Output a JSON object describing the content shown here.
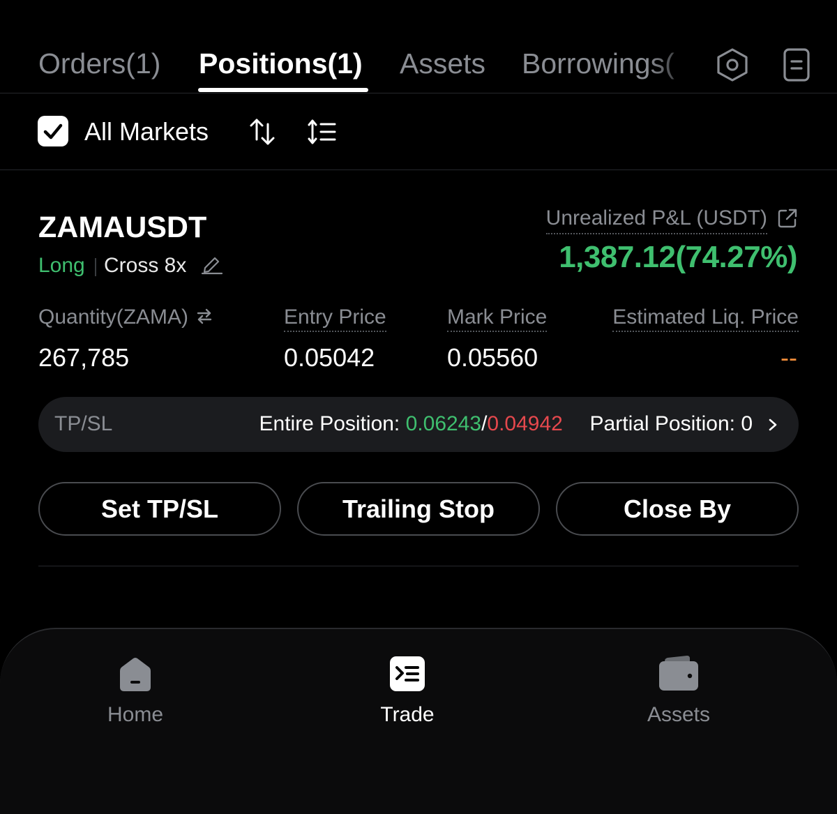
{
  "tabs": [
    {
      "label": "Orders(1)",
      "active": false
    },
    {
      "label": "Positions(1)",
      "active": true
    },
    {
      "label": "Assets",
      "active": false
    },
    {
      "label": "Borrowings(",
      "active": false
    }
  ],
  "header_icons": [
    "settings-hexagon-icon",
    "document-icon"
  ],
  "filter": {
    "all_markets_label": "All Markets",
    "all_markets_checked": true,
    "icons": [
      "sort-arrows-icon",
      "sort-list-icon"
    ]
  },
  "position": {
    "symbol": "ZAMAUSDT",
    "side": "Long",
    "margin_mode": "Cross 8x",
    "pnl_label": "Unrealized P&L (USDT)",
    "pnl_value": "1,387.12(74.27%)",
    "columns": [
      {
        "label": "Quantity(ZAMA)",
        "value": "267,785"
      },
      {
        "label": "Entry Price",
        "value": "0.05042"
      },
      {
        "label": "Mark Price",
        "value": "0.05560"
      },
      {
        "label": "Estimated Liq. Price",
        "value": "--"
      }
    ],
    "tpsl": {
      "label": "TP/SL",
      "entire_label": "Entire Position: ",
      "tp": "0.06243",
      "separator": "/",
      "sl": "0.04942",
      "partial_label": "Partial Position: 0"
    },
    "buttons": {
      "set_tpsl": "Set TP/SL",
      "trailing_stop": "Trailing Stop",
      "close_by": "Close By"
    }
  },
  "nav": [
    {
      "label": "Home",
      "icon": "home-icon",
      "active": false
    },
    {
      "label": "Trade",
      "icon": "trade-icon",
      "active": true
    },
    {
      "label": "Assets",
      "icon": "wallet-icon",
      "active": false
    }
  ],
  "colors": {
    "positive": "#3fbf6f",
    "negative": "#e5484d",
    "liq_placeholder": "#f08c3a",
    "muted": "#8a8d93"
  }
}
